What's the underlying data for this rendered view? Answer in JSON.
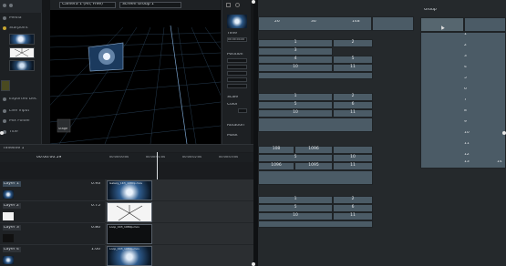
{
  "media": {
    "title": "Media",
    "items": [
      "Starpoint",
      "Exported Dec",
      "Live Input",
      "Mix Folder",
      "Title"
    ]
  },
  "viewport": {
    "camera_select": "Camera 1 (All, Free)",
    "screen_select": "Screen Group 1",
    "corner_label": "Stage"
  },
  "inspector": {
    "labels": [
      "Time",
      "Position",
      "Scale",
      "Color",
      "Rotation",
      "Mask"
    ],
    "time_value": "00:00:00.00"
  },
  "timeline": {
    "title": "Timeline 1",
    "timecode": "00:00:00.59",
    "ruler": [
      "00:00:00:00",
      "00:00:01:00",
      "00:00:02:00",
      "00:00:03:00"
    ],
    "layers": [
      {
        "name": "Layer 1",
        "opacity": "0.93",
        "clip": "Galaxy_1K3_1080p.mov"
      },
      {
        "name": "Layer 2",
        "opacity": "0.75",
        "clip": "Light Burst"
      },
      {
        "name": "Layer 3",
        "opacity": "0.80",
        "clip": "Loop_1K3_1080p.mov"
      },
      {
        "name": "Layer 4",
        "opacity": "1.00",
        "clip": "Loop_1K3_1080p.mov"
      }
    ]
  },
  "grid": {
    "group_title": "Group",
    "colors": {
      "cell": "#4b5b66",
      "panel": "#25292c"
    },
    "blocks": [
      {
        "rows": [
          "26",
          "36",
          "148",
          ""
        ],
        "subrows": [
          [
            "1",
            "2",
            "3"
          ],
          [
            "4",
            "5",
            "6"
          ],
          [
            "10",
            "11",
            "12"
          ]
        ]
      },
      {
        "subrows": [
          [
            "1",
            "2",
            "3"
          ],
          [
            "5",
            "6",
            "7"
          ],
          [
            "10",
            "11",
            "12"
          ]
        ]
      },
      {
        "rows": [
          "108",
          "1096",
          ""
        ],
        "subrows": [
          [
            "5",
            "10",
            "11"
          ],
          [
            "1096",
            "1095"
          ]
        ]
      },
      {
        "subrows": [
          [
            "1",
            "2",
            "3"
          ],
          [
            "5",
            "6",
            "7"
          ],
          [
            "10",
            "11",
            "12"
          ]
        ]
      }
    ],
    "right_column": [
      "1",
      "2",
      "3",
      "4",
      "5",
      "6",
      "7",
      "8",
      "9",
      "10",
      "11",
      "12",
      "13",
      "14"
    ]
  }
}
